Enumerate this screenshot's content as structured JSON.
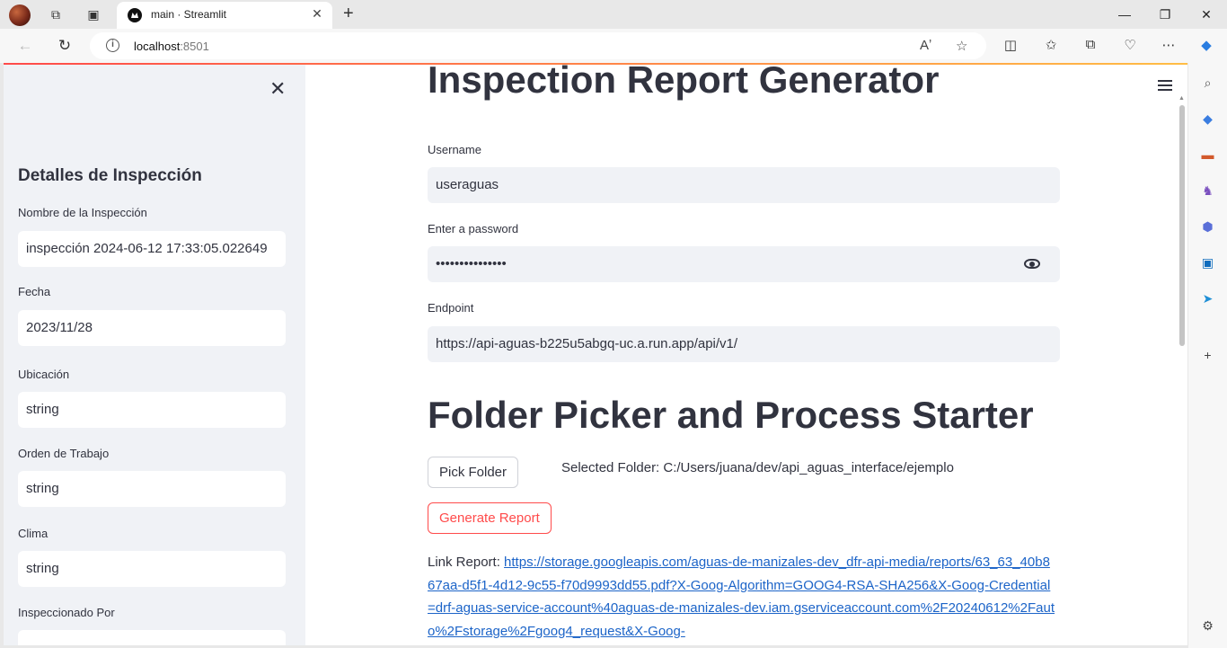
{
  "browser": {
    "tab_title": "main · Streamlit",
    "url_host": "localhost",
    "url_port": ":8501"
  },
  "sidebar": {
    "title": "Detalles de Inspección",
    "fields": [
      {
        "label": "Nombre de la Inspección",
        "value": "inspección 2024-06-12 17:33:05.022649"
      },
      {
        "label": "Fecha",
        "value": "2023/11/28"
      },
      {
        "label": "Ubicación",
        "value": "string"
      },
      {
        "label": "Orden de Trabajo",
        "value": "string"
      },
      {
        "label": "Clima",
        "value": "string"
      },
      {
        "label": "Inspeccionado Por",
        "value": ""
      }
    ]
  },
  "main": {
    "title_partial": "Inspection Report Generator",
    "username": {
      "label": "Username",
      "value": "useraguas"
    },
    "password": {
      "label": "Enter a password",
      "value": "•••••••••••••••"
    },
    "endpoint": {
      "label": "Endpoint",
      "value": "https://api-aguas-b225u5abgq-uc.a.run.app/api/v1/"
    },
    "section_title": "Folder Picker and Process Starter",
    "pick_folder_label": "Pick Folder",
    "selected_folder": "Selected Folder: C:/Users/juana/dev/api_aguas_interface/ejemplo",
    "generate_report_label": "Generate Report",
    "link_report_label": "Link Report: ",
    "link_report_url": "https://storage.googleapis.com/aguas-de-manizales-dev_dfr-api-media/reports/63_63_40b867aa-d5f1-4d12-9c55-f70d9993dd55.pdf?X-Goog-Algorithm=GOOG4-RSA-SHA256&X-Goog-Credential=drf-aguas-service-account%40aguas-de-manizales-dev.iam.gserviceaccount.com%2F20240612%2Fauto%2Fstorage%2Fgoog4_request&X-Goog-"
  }
}
